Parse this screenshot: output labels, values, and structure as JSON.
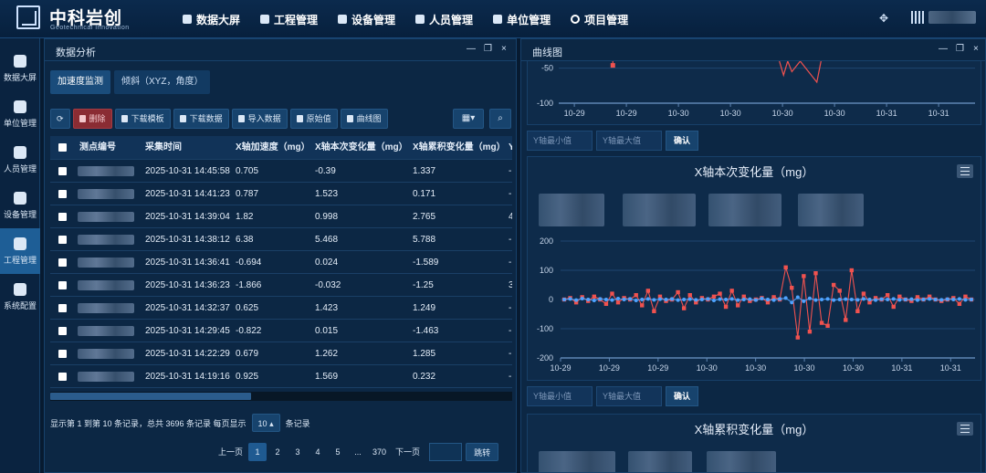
{
  "app": {
    "brand": "中科岩创",
    "brand_sub": "Geotechnical Innovation"
  },
  "topnav": [
    {
      "label": "数据大屏",
      "icon": "cube-icon"
    },
    {
      "label": "工程管理",
      "icon": "chart-icon"
    },
    {
      "label": "设备管理",
      "icon": "gear-icon"
    },
    {
      "label": "人员管理",
      "icon": "person-icon"
    },
    {
      "label": "单位管理",
      "icon": "calendar-check-icon"
    },
    {
      "label": "项目管理",
      "icon": "circle-icon"
    }
  ],
  "sidebar": [
    {
      "label": "数据大屏",
      "icon": "cube-icon"
    },
    {
      "label": "单位管理",
      "icon": "calendar-check-icon"
    },
    {
      "label": "人员管理",
      "icon": "person-icon"
    },
    {
      "label": "设备管理",
      "icon": "gear-icon"
    },
    {
      "label": "工程管理",
      "icon": "chart-icon",
      "active": true
    },
    {
      "label": "系统配置",
      "icon": "dots-icon"
    }
  ],
  "left_panel": {
    "title": "数据分析",
    "tabs": [
      "加速度监测",
      "倾斜（XYZ，角度）"
    ],
    "toolbar": {
      "delete": "删除",
      "download_template": "下载模板",
      "download_data": "下载数据",
      "import_data": "导入数据",
      "raw_values": "原始值",
      "curve_chart": "曲线图"
    },
    "table": {
      "headers": [
        "测点编号",
        "采集时间",
        "X轴加速度（mg）",
        "X轴本次变化量（mg）",
        "X轴累积变化量（mg）",
        "Y"
      ],
      "rows": [
        [
          "2025-10-31 14:45:58",
          "0.705",
          "-0.39",
          "1.337",
          "-"
        ],
        [
          "2025-10-31 14:41:23",
          "0.787",
          "1.523",
          "0.171",
          "-"
        ],
        [
          "2025-10-31 14:39:04",
          "1.82",
          "0.998",
          "2.765",
          "4"
        ],
        [
          "2025-10-31 14:38:12",
          "6.38",
          "5.468",
          "5.788",
          "-"
        ],
        [
          "2025-10-31 14:36:41",
          "-0.694",
          "0.024",
          "-1.589",
          "-"
        ],
        [
          "2025-10-31 14:36:23",
          "-1.866",
          "-0.032",
          "-1.25",
          "3"
        ],
        [
          "2025-10-31 14:32:37",
          "0.625",
          "1.423",
          "1.249",
          "-"
        ],
        [
          "2025-10-31 14:29:45",
          "-0.822",
          "0.015",
          "-1.463",
          "-"
        ],
        [
          "2025-10-31 14:22:29",
          "0.679",
          "1.262",
          "1.285",
          "-"
        ],
        [
          "2025-10-31 14:19:16",
          "0.925",
          "1.569",
          "0.232",
          "-"
        ]
      ]
    },
    "pager": {
      "info_pre": "显示第 1 到第 10 条记录，总共 3696 条记录 每页显示",
      "page_size": "10",
      "info_post": "条记录",
      "prev": "上一页",
      "pages": [
        "1",
        "2",
        "3",
        "4",
        "5",
        "...",
        "370"
      ],
      "next": "下一页",
      "go": "跳转"
    }
  },
  "right_panel": {
    "title": "曲线图",
    "y_min_placeholder": "Y轴最小值",
    "y_max_placeholder": "Y轴最大值",
    "confirm": "确认"
  },
  "chart_data": [
    {
      "type": "line",
      "title": "",
      "x_ticks": [
        "10-29",
        "10-29",
        "10-30",
        "10-30",
        "10-30",
        "10-30",
        "10-31",
        "10-31"
      ],
      "y_ticks": [
        -50,
        -100
      ],
      "ylim": [
        -100,
        -40
      ],
      "series": [
        {
          "color": "#f0524f",
          "points": [
            [
              0.13,
              -40
            ],
            [
              0.13,
              -46
            ],
            [
              0.13,
              -40
            ]
          ]
        },
        {
          "color": "#f0524f",
          "points": [
            [
              0.53,
              -40
            ],
            [
              0.54,
              -60
            ],
            [
              0.55,
              -40
            ],
            [
              0.56,
              -55
            ],
            [
              0.58,
              -40
            ],
            [
              0.62,
              -70
            ],
            [
              0.63,
              -40
            ]
          ]
        }
      ]
    },
    {
      "type": "line",
      "title": "X轴本次变化量（mg）",
      "x_ticks": [
        "10-29",
        "10-29",
        "10-29",
        "10-30",
        "10-30",
        "10-30",
        "10-30",
        "10-31",
        "10-31"
      ],
      "y_ticks": [
        200,
        100,
        0,
        -100,
        -200
      ],
      "ylim": [
        -200,
        200
      ],
      "series": [
        {
          "name": "",
          "color": "#f0524f",
          "values": [
            0,
            5,
            -10,
            8,
            -5,
            10,
            0,
            -15,
            20,
            -10,
            5,
            0,
            15,
            -20,
            30,
            -40,
            10,
            -5,
            0,
            25,
            -30,
            15,
            -10,
            5,
            0,
            10,
            20,
            -25,
            30,
            -20,
            10,
            -5,
            0,
            5,
            -10,
            8,
            0,
            110,
            40,
            -130,
            80,
            -110,
            90,
            -80,
            -90,
            50,
            30,
            -70,
            100,
            -40,
            20,
            -10,
            5,
            0,
            15,
            -25,
            10,
            0,
            -5,
            8,
            0,
            10,
            0,
            -5,
            0,
            5,
            -15,
            10,
            0
          ]
        },
        {
          "name": "",
          "color": "#4ea3ff",
          "values": [
            0,
            2,
            -2,
            3,
            0,
            -3,
            2,
            0,
            -2,
            3,
            0,
            2,
            -3,
            0,
            2,
            -1,
            1,
            0,
            2,
            -2,
            0,
            1,
            -1,
            0,
            2,
            -3,
            1,
            0,
            2,
            -2,
            0,
            1,
            -2,
            3,
            0,
            -2,
            2,
            5,
            -10,
            8,
            -6,
            4,
            -2,
            0,
            2,
            -2,
            0,
            1,
            0,
            -1,
            2,
            0,
            -2,
            1,
            0,
            2,
            -1,
            0,
            1,
            -2,
            0,
            2,
            0,
            -1,
            1,
            0,
            2,
            -1,
            0
          ]
        }
      ]
    },
    {
      "type": "line",
      "title": "X轴累积变化量（mg）"
    }
  ]
}
